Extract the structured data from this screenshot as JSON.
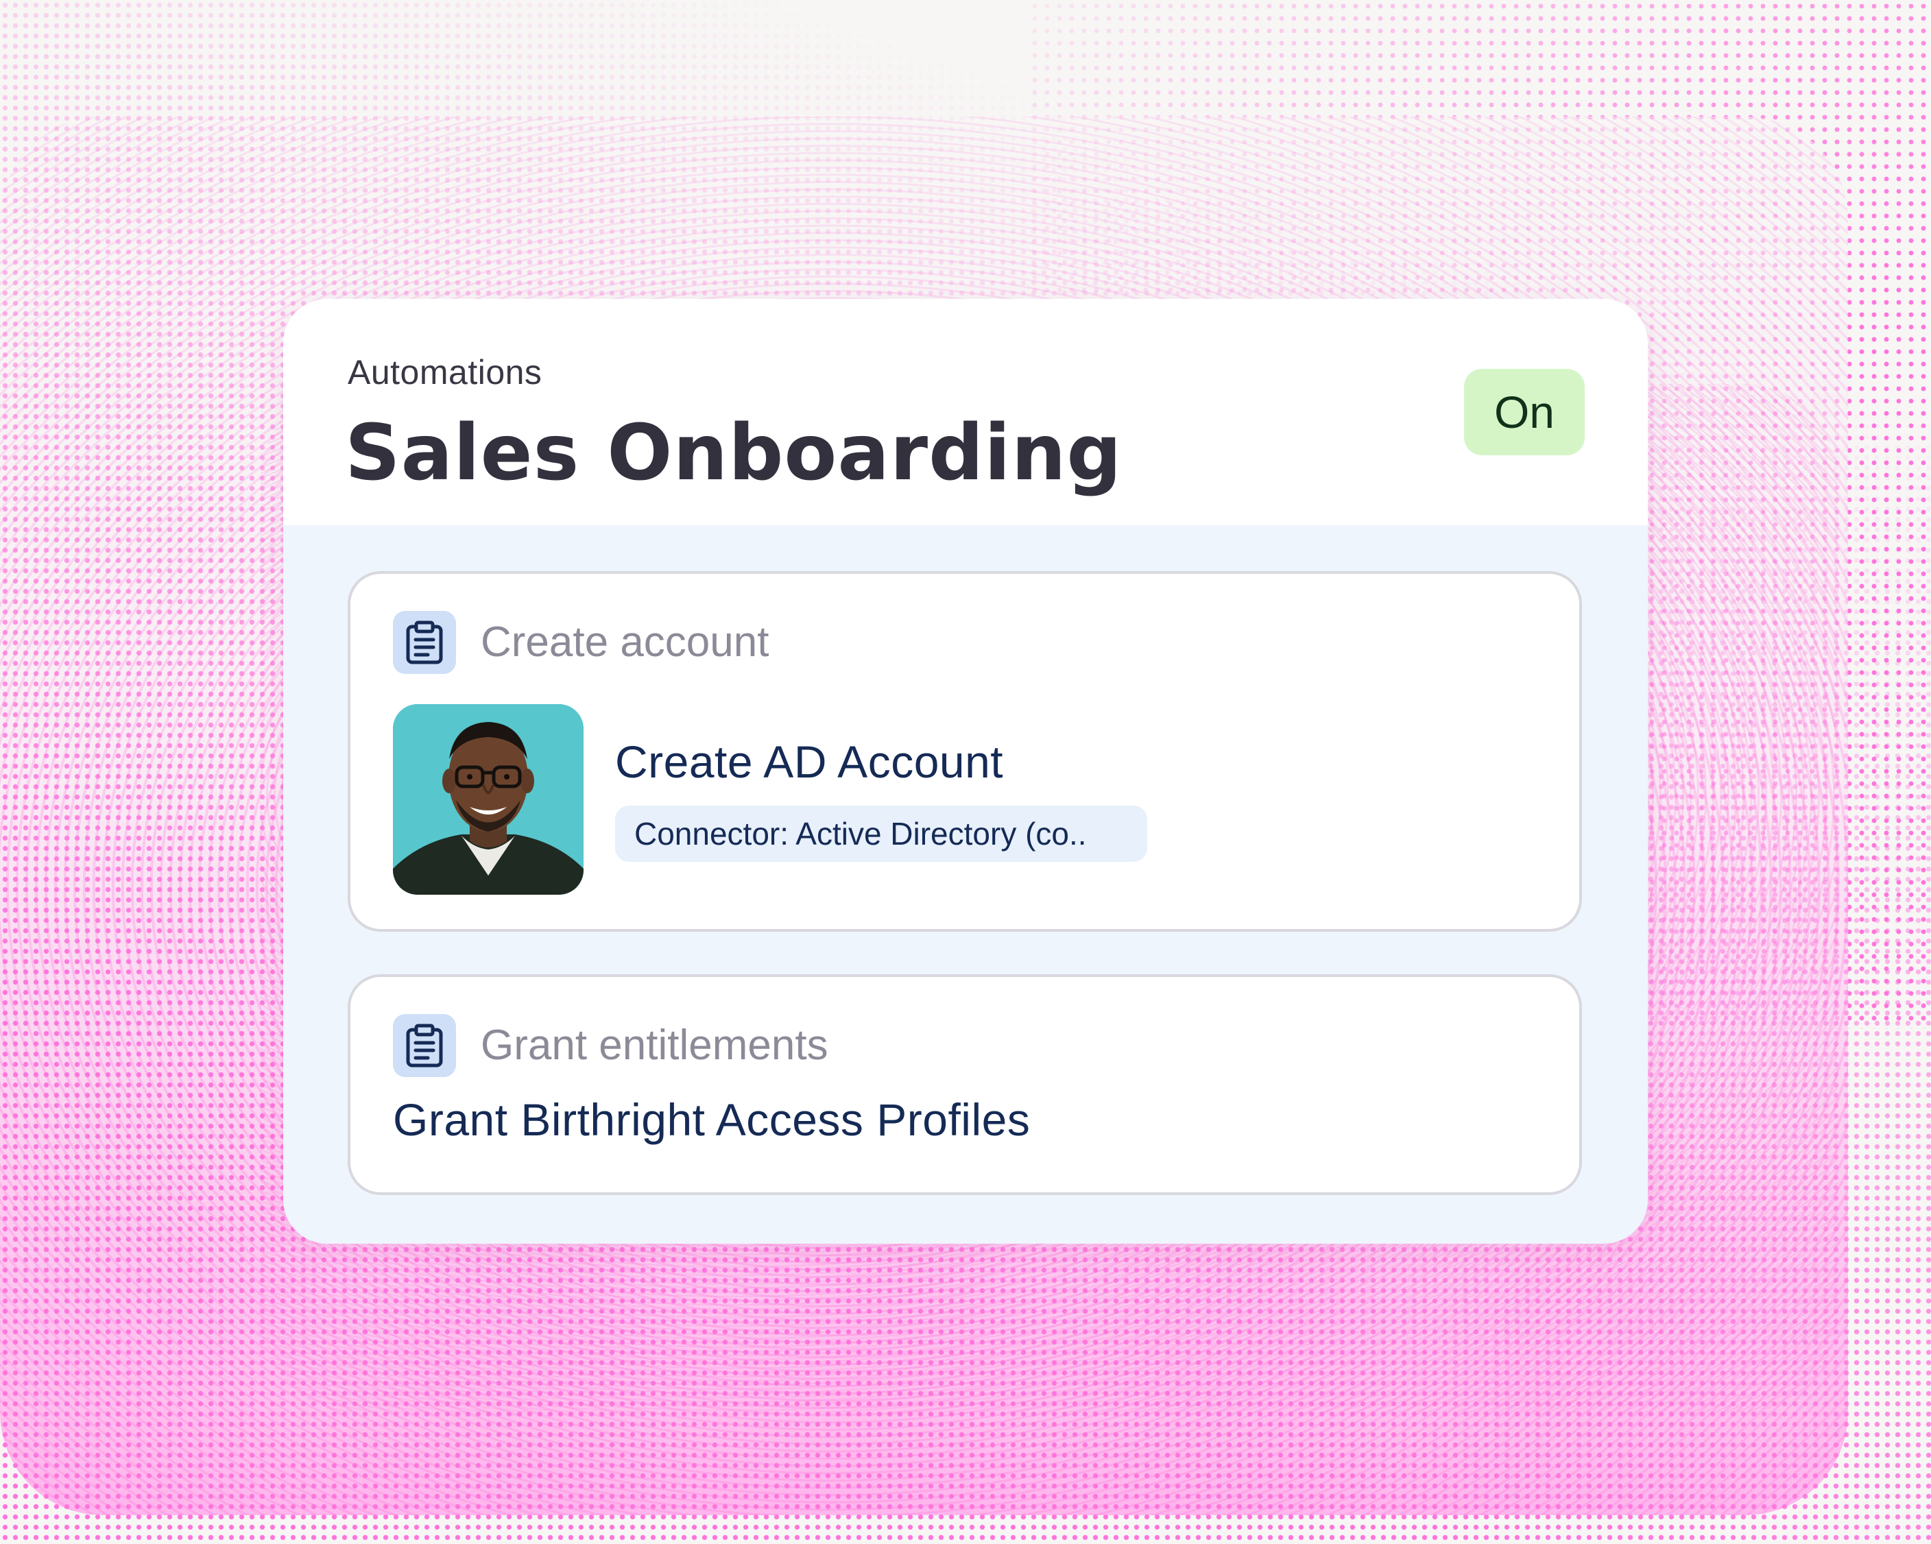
{
  "automation": {
    "eyebrow": "Automations",
    "title": "Sales Onboarding",
    "status": "On"
  },
  "steps": [
    {
      "label": "Create account",
      "icon": "clipboard-icon",
      "action_title": "Create AD Account",
      "connector": "Connector: Active Directory (co.."
    },
    {
      "label": "Grant entitlements",
      "icon": "clipboard-icon",
      "action_title": "Grant Birthright Access Profiles"
    }
  ],
  "colors": {
    "accent_pink": "#ff74dc",
    "status_on_bg": "#d5f5c7",
    "card_bg": "#eef5fd",
    "title_text": "#152a55",
    "icon_bg": "#cfdff7"
  }
}
